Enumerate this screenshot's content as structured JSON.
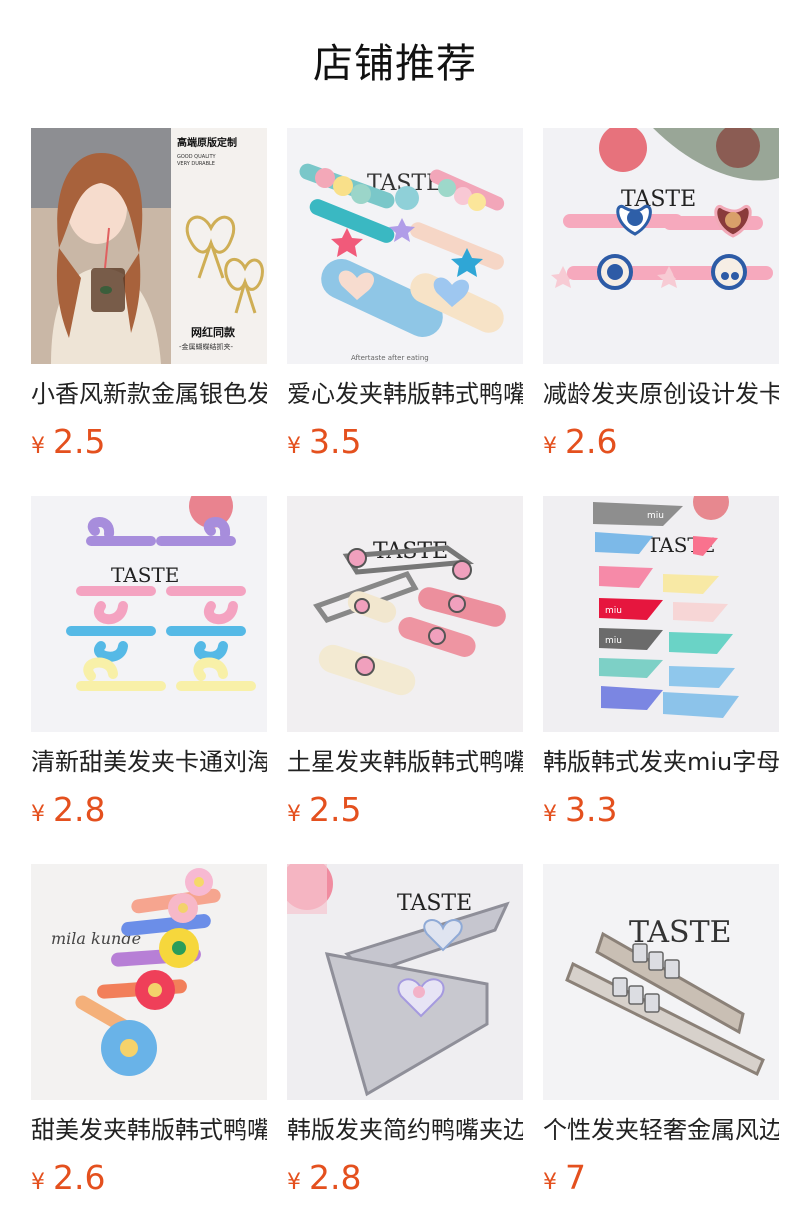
{
  "header": {
    "title": "店铺推荐"
  },
  "currency_symbol": "¥",
  "products": [
    {
      "name": "小香风新款金属银色发夹",
      "price": "2.5",
      "image_text": {
        "line1": "高端原版定制",
        "line2": "GOOD QUALITY",
        "line3": "VERY DURABLE",
        "line4": "网红同款",
        "line5": "-金属蝴蝶结抓夹-"
      }
    },
    {
      "name": "爱心发夹韩版韩式鸭嘴夹",
      "price": "3.5",
      "image_text": {
        "brand": "TASTE",
        "caption": "Aftertaste after eating"
      }
    },
    {
      "name": "减龄发夹原创设计发卡",
      "price": "2.6",
      "image_text": {
        "brand": "TASTE"
      }
    },
    {
      "name": "清新甜美发夹卡通刘海夹",
      "price": "2.8",
      "image_text": {
        "brand": "TASTE"
      }
    },
    {
      "name": "土星发夹韩版韩式鸭嘴夹",
      "price": "2.5",
      "image_text": {
        "brand": "TASTE"
      }
    },
    {
      "name": "韩版韩式发夹miu字母夹",
      "price": "3.3",
      "image_text": {
        "brand": "TASTE",
        "clip_text": "miu"
      }
    },
    {
      "name": "甜美发夹韩版韩式鸭嘴夹",
      "price": "2.6",
      "image_text": {
        "brand": "mila kunde"
      }
    },
    {
      "name": "韩版发夹简约鸭嘴夹边夹",
      "price": "2.8",
      "image_text": {
        "brand": "TASTE"
      }
    },
    {
      "name": "个性发夹轻奢金属风边夹",
      "price": "7",
      "image_text": {
        "brand": "TASTE"
      }
    }
  ]
}
